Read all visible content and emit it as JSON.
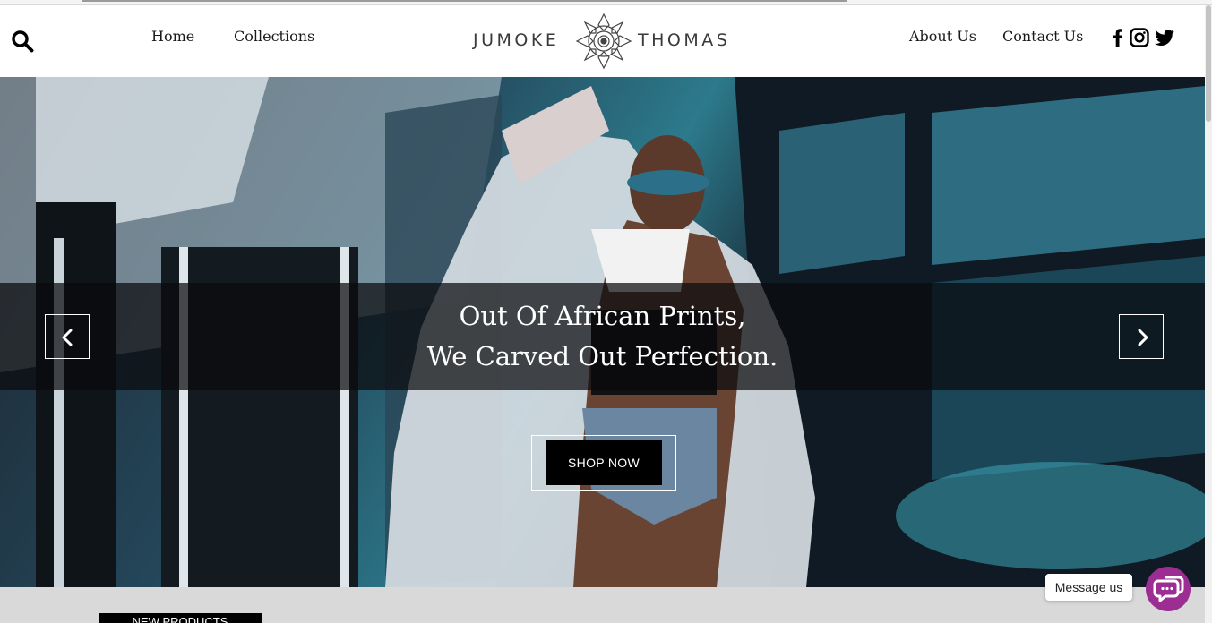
{
  "header": {
    "nav_left": [
      "Home",
      "Collections"
    ],
    "nav_right": [
      "About Us",
      "Contact Us"
    ],
    "logo": {
      "left_word": "JUMOKE",
      "right_word": "THOMAS"
    },
    "social_icons": [
      "facebook-icon",
      "instagram-icon",
      "twitter-icon"
    ]
  },
  "hero": {
    "title_line1": "Out Of African Prints,",
    "title_line2": "We Carved Out Perfection.",
    "cta_label": "SHOP NOW",
    "prev_icon": "chevron-left-icon",
    "next_icon": "chevron-right-icon"
  },
  "section": {
    "label": "NEW PRODUCTS"
  },
  "chat": {
    "label": "Message us",
    "icon": "chat-bubble-icon",
    "color": "#9b2d93"
  },
  "colors": {
    "accent_chat": "#9b2d93",
    "hero_band": "#0a0a0c",
    "button": "#000000"
  }
}
